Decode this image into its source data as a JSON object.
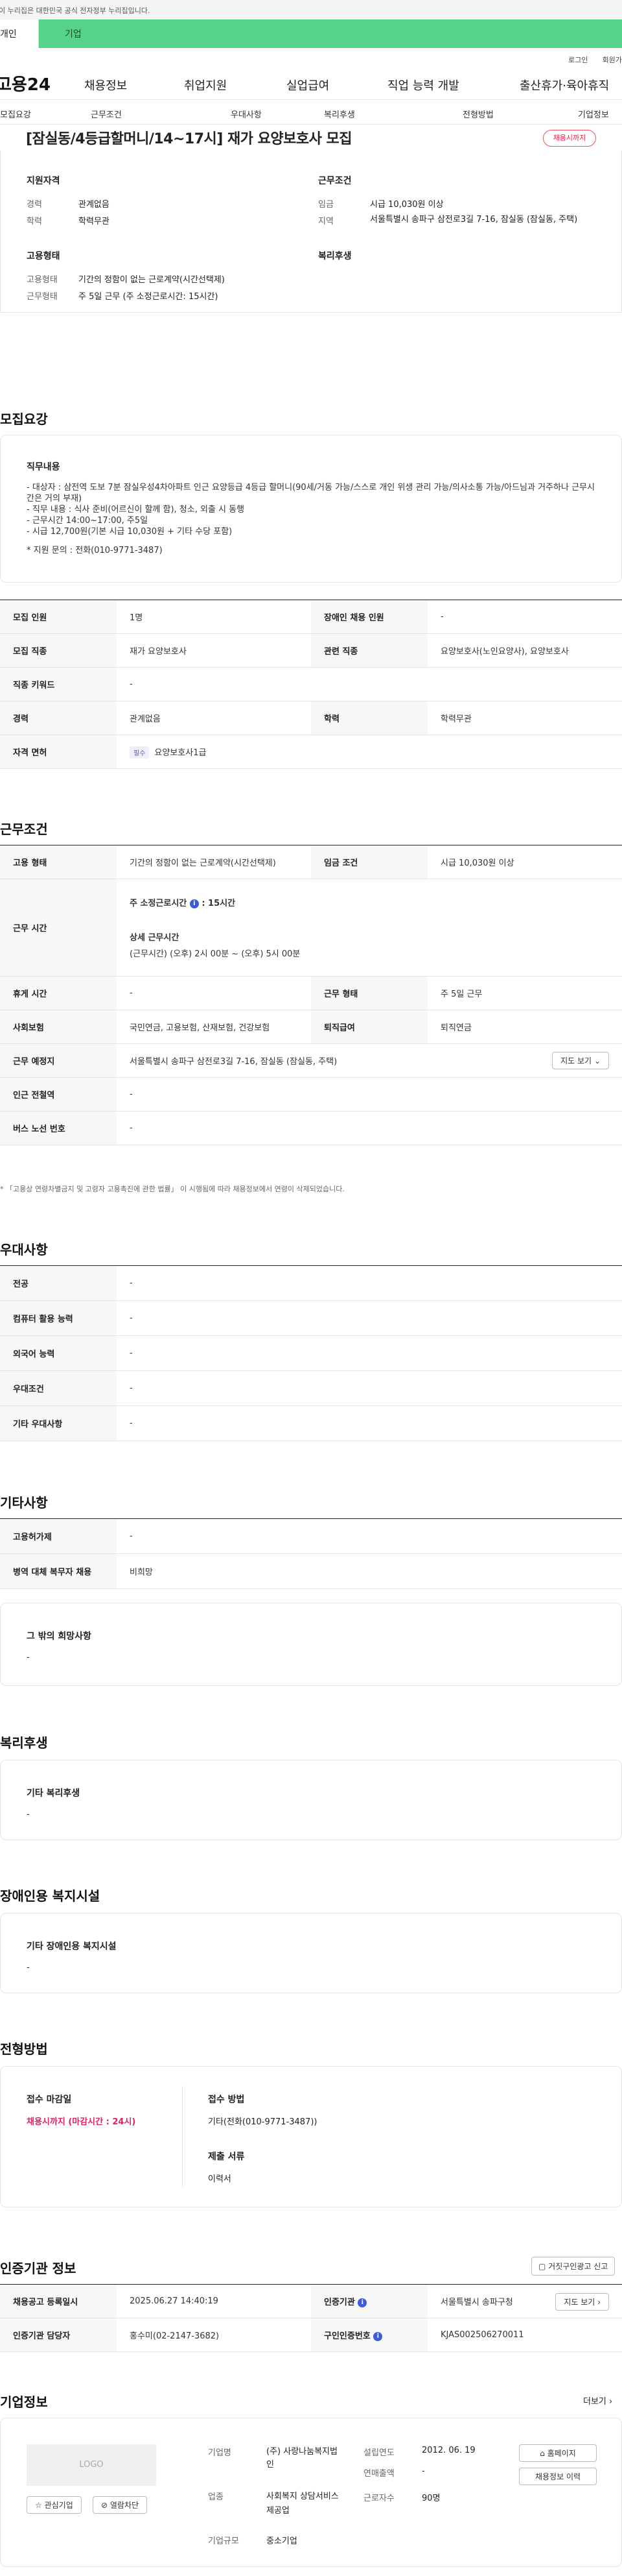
{
  "gov_banner": "이 누리집은 대한민국 공식 전자정부 누리집입니다.",
  "user_tabs": [
    "개인",
    "기업"
  ],
  "top_links": [
    "로그인",
    "회원가입"
  ],
  "logo": "고용24",
  "gnb": [
    "채용정보",
    "취업지원",
    "실업급여",
    "직업 능력 개발",
    "출산휴가·육아휴직"
  ],
  "subnav": [
    "모집요강",
    "근무조건",
    "우대사항",
    "복리후생",
    "전형방법",
    "기업정보"
  ],
  "job": {
    "title": "[잠실동/4등급할머니/14~17시] 재가 요양보호사 모집",
    "dday": "채용시까지"
  },
  "summary": {
    "qual_title": "지원자격",
    "career_label": "경력",
    "career_value": "관계없음",
    "edu_label": "학력",
    "edu_value": "학력무관",
    "work_title": "근무조건",
    "wage_label": "임금",
    "wage_value": "시급 10,030원 이상",
    "region_label": "지역",
    "region_value": "서울특별시 송파구 삼전로3길 7-16, 잠실동 (잠실동, 주택)",
    "emp_title": "고용형태",
    "emp_type_label": "고용형태",
    "emp_type_value": "기간의 정함이 없는 근로계약(시간선택제)",
    "work_form_label": "근무형태",
    "work_form_value": "주 5일 근무 (주 소정근로시간: 15시간)",
    "welfare_title": "복리후생"
  },
  "recruit": {
    "section": "모집요강",
    "duty_title": "직무내용",
    "duty_lines": [
      "- 대상자 : 삼전역 도보 7분 잠실우성4차아파트 인근 요양등급 4등급 할머니(90세/거동 가능/스스로 개인 위생 관리 가능/의사소통 가능/아드님과 거주하나 근무시간은 거의 부재)",
      "- 직무 내용 : 식사 준비(어르신이 할께 함), 청소, 외출 시 동행",
      "- 근무시간 14:00~17:00, 주5일",
      "- 시급 12,700원(기본 시급 10,030원 + 기타 수당 포함)",
      "",
      "* 지원 문의 : 전화(010-9771-3487)"
    ],
    "rows": [
      {
        "k1": "모집 인원",
        "v1": "1명",
        "k2": "장애인 채용 인원",
        "v2": "-"
      },
      {
        "k1": "모집 직종",
        "v1": "재가 요양보호사",
        "k2": "관련 직종",
        "v2": "요양보호사(노인요양사), 요양보호사"
      },
      {
        "k1": "직종 키워드",
        "v1": "-"
      },
      {
        "k1": "경력",
        "v1": "관계없음",
        "k2": "학력",
        "v2": "학력무관"
      },
      {
        "k1": "자격 면허",
        "badge": "필수",
        "v1": "요양보호사1급"
      }
    ]
  },
  "conditions": {
    "section": "근무조건",
    "emp_k": "고용 형태",
    "emp_v": "기간의 정함이 없는 근로계약(시간선택제)",
    "wage_k": "임금 조건",
    "wage_v": "시급 10,030원 이상",
    "time_k": "근무 시간",
    "weekly_label": "주 소정근로시간",
    "weekly_value": ": 15시간",
    "detail_label": "상세 근무시간",
    "detail_value": "(근무시간) (오후) 2시 00분 ~ (오후) 5시 00분",
    "rest_k": "휴게 시간",
    "rest_v": "-",
    "form_k": "근무 형태",
    "form_v": "주 5일 근무",
    "ins_k": "사회보험",
    "ins_v": "국민연금, 고용보험, 산재보험, 건강보험",
    "ret_k": "퇴직급여",
    "ret_v": "퇴직연금",
    "place_k": "근무 예정지",
    "place_v": "서울특별시 송파구 삼전로3길 7-16, 잠실동 (잠실동, 주택)",
    "map_btn": "지도 보기",
    "subway_k": "인근 전철역",
    "subway_v": "-",
    "bus_k": "버스 노선 번호",
    "bus_v": "-",
    "note": "* 「고용상 연령차별금지 및 고령자 고용촉진에 관한 법률」 이 시행됨에 따라 채용정보에서 연령이 삭제되었습니다."
  },
  "preference": {
    "section": "우대사항",
    "rows": [
      [
        "전공",
        "-"
      ],
      [
        "컴퓨터 활용 능력",
        "-"
      ],
      [
        "외국어 능력",
        "-"
      ],
      [
        "우대조건",
        "-"
      ],
      [
        "기타 우대사항",
        "-"
      ]
    ]
  },
  "etc": {
    "section": "기타사항",
    "rows": [
      [
        "고용허가제",
        "-"
      ],
      [
        "병역 대체 복무자 채용",
        "비희망"
      ]
    ],
    "other_title": "그 밖의 희망사항",
    "other_value": "-"
  },
  "welfare": {
    "section": "복리후생",
    "title": "기타 복리후생",
    "value": "-"
  },
  "disability": {
    "section": "장애인용 복지시설",
    "title": "기타 장애인용 복지시설",
    "value": "-"
  },
  "process": {
    "section": "전형방법",
    "deadline_label": "접수 마감일",
    "deadline_value": "채용시까지 (마감시간 : 24시)",
    "method_label": "접수 방법",
    "method_value": "기타(전화(010-9771-3487))",
    "docs_label": "제출 서류",
    "docs_value": "이력서"
  },
  "cert": {
    "section": "인증기관 정보",
    "report_btn": "거짓구인광고 신고",
    "reg_k": "채용공고 등록일시",
    "reg_v": "2025.06.27 14:40:19",
    "org_k": "인증기관",
    "org_v": "서울특별시 송파구청",
    "manager_k": "인증기관 담당자",
    "manager_v": "홍수미(02-2147-3682)",
    "cert_no_k": "구인인증번호",
    "cert_no_v": "KJAS002506270011",
    "map_btn": "지도 보기"
  },
  "company": {
    "section": "기업정보",
    "more": "더보기",
    "logo": "LOGO",
    "fav_btn": "관심기업",
    "block_btn": "열람차단",
    "name_k": "기업명",
    "name_v": "(주) 사랑나눔복지법인",
    "year_k": "설립연도",
    "year_v": "2012. 06. 19",
    "sales_k": "연매출액",
    "sales_v": "-",
    "industry_k": "업종",
    "industry_v": "사회복지 상담서비스 제공업",
    "emp_k": "근로자수",
    "emp_v": "90명",
    "size_k": "기업규모",
    "size_v": "중소기업",
    "home_btn": "홈페이지",
    "hist_btn": "채용정보 이력"
  }
}
